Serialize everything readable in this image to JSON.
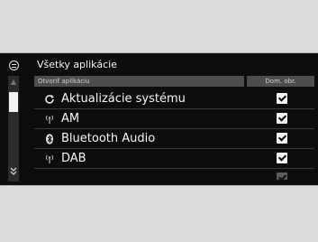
{
  "screen": {
    "title": "Všetky aplikácie",
    "header": {
      "app_col": "Otvoriť aplikáciu",
      "home_col": "Dom. obr."
    },
    "items": [
      {
        "label": "Aktualizácie systému",
        "icon": "refresh-icon",
        "checked": true
      },
      {
        "label": "AM",
        "icon": "radio-antenna-icon",
        "checked": true
      },
      {
        "label": "Bluetooth Audio",
        "icon": "bluetooth-icon",
        "checked": true
      },
      {
        "label": "DAB",
        "icon": "radio-antenna-icon",
        "checked": true
      }
    ],
    "scroll_up_glyph": "▲",
    "scroll_down_glyph": "⏬"
  }
}
